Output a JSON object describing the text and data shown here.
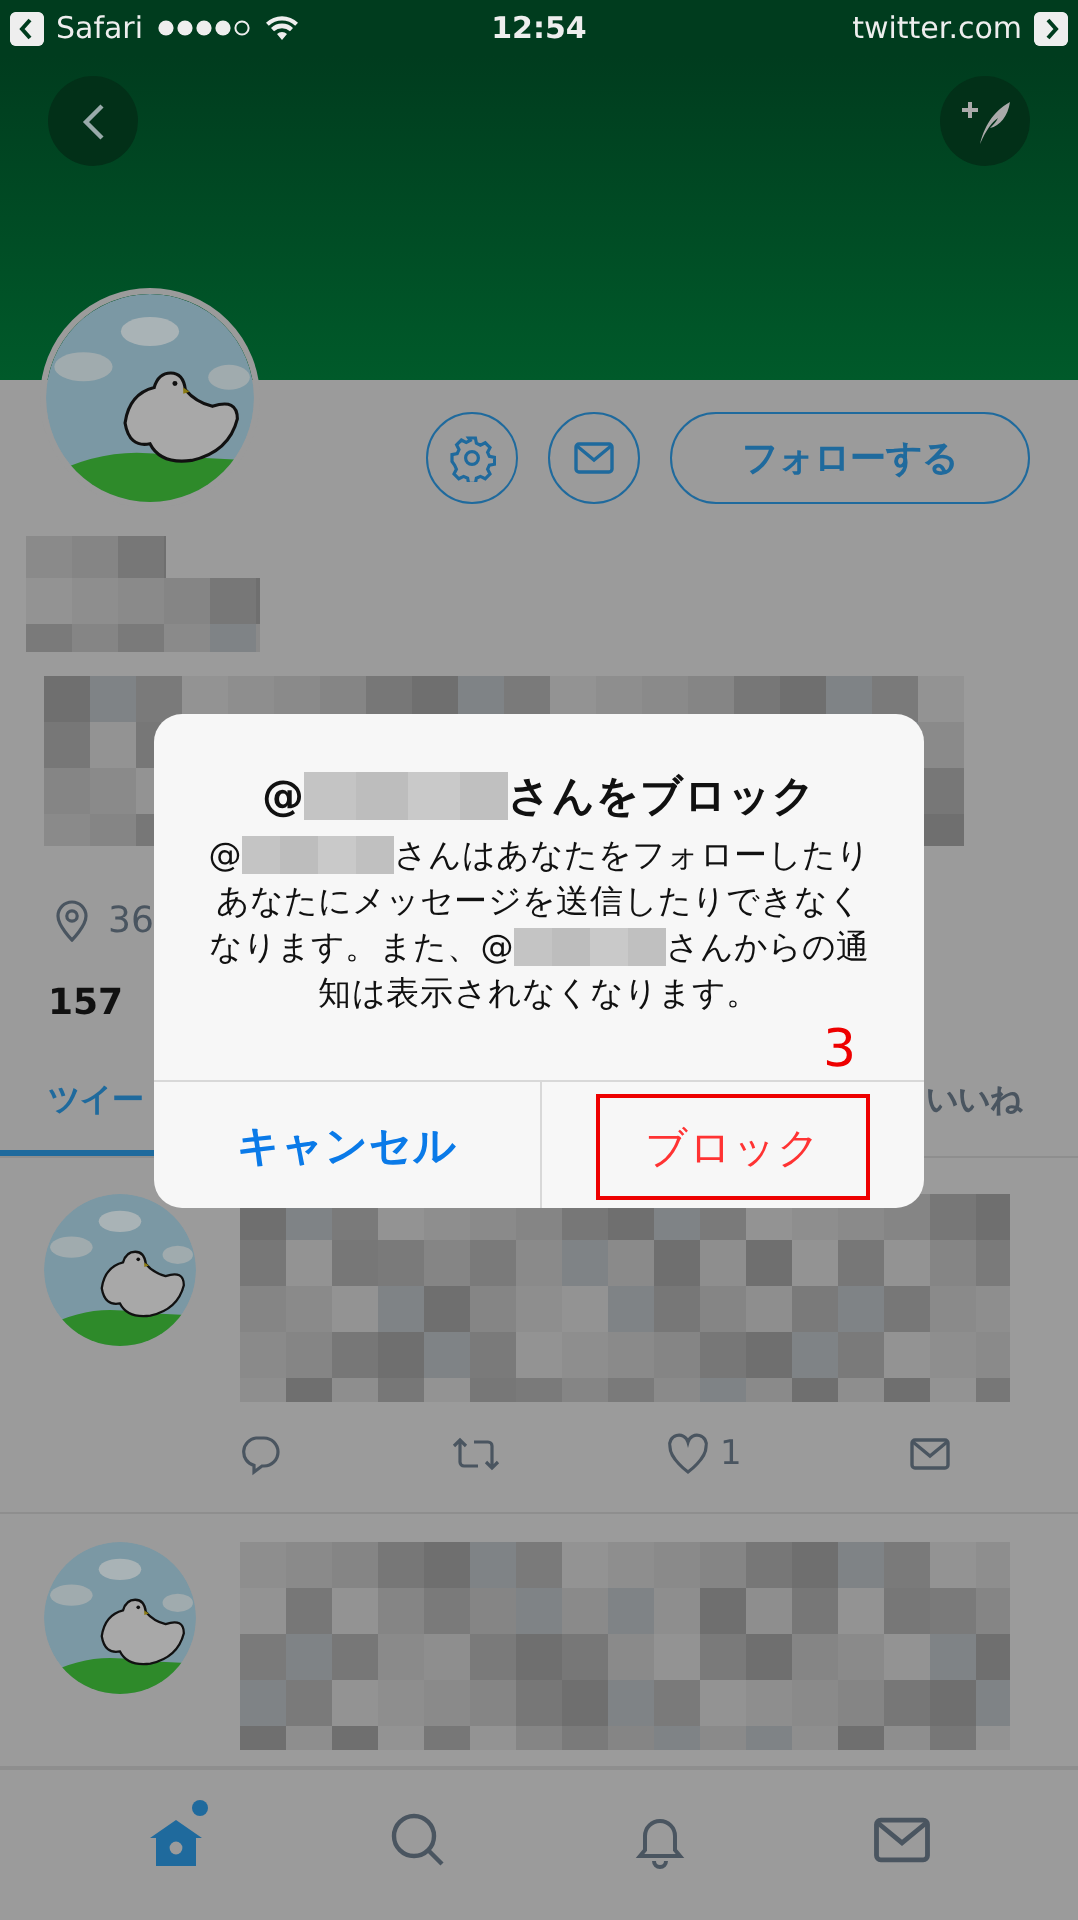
{
  "status_bar": {
    "back_label": "Safari",
    "time": "12:54",
    "url": "twitter.com"
  },
  "profile": {
    "follow_button": "フォローする",
    "location": "36",
    "count": "157"
  },
  "tabs": [
    {
      "label": "ツイー",
      "selected": true
    },
    {
      "label": "いいね",
      "selected": false
    }
  ],
  "tweets": [
    {
      "kind": "full",
      "like_count": "1"
    },
    {
      "kind": "partial"
    }
  ],
  "tab_bar": [
    {
      "kind": "home",
      "selected": true,
      "badge": true
    },
    {
      "kind": "search",
      "selected": false,
      "badge": false
    },
    {
      "kind": "notifications",
      "selected": false,
      "badge": false
    },
    {
      "kind": "messages",
      "selected": false,
      "badge": false
    }
  ],
  "dialog": {
    "title": [
      {
        "kind": "text",
        "text": "@"
      },
      {
        "kind": "redacted"
      },
      {
        "kind": "text",
        "text": "さんをブロック"
      }
    ],
    "message_lines": [
      [
        {
          "kind": "text",
          "text": "@"
        },
        {
          "kind": "redacted"
        },
        {
          "kind": "text",
          "text": "さんはあなたをフォローしたり"
        }
      ],
      [
        {
          "kind": "text",
          "text": "あなたにメッセージを送信したりできなく"
        }
      ],
      [
        {
          "kind": "text",
          "text": "なります。また、@"
        },
        {
          "kind": "redacted"
        },
        {
          "kind": "text",
          "text": "さんからの通"
        }
      ],
      [
        {
          "kind": "text",
          "text": "知は表示されなくなります。"
        }
      ]
    ],
    "buttons": [
      {
        "label": "キャンセル",
        "kind": "cancel",
        "highlighted": false
      },
      {
        "label": "ブロック",
        "kind": "destructive",
        "highlighted": true
      }
    ],
    "annotation": "3"
  }
}
